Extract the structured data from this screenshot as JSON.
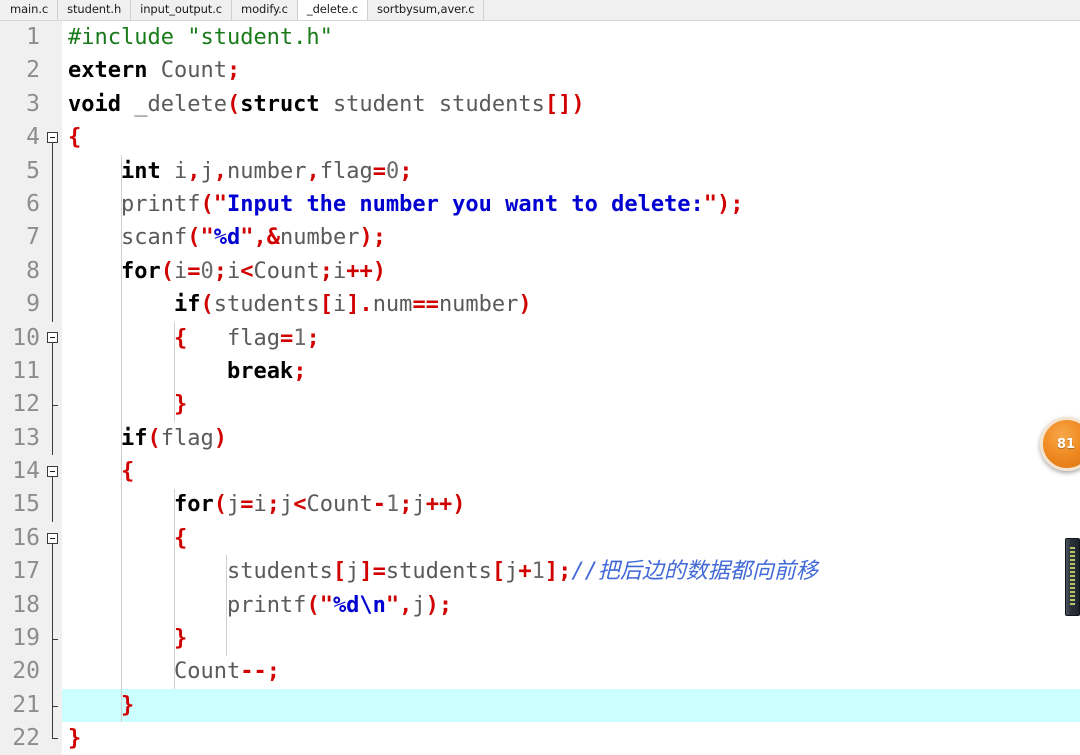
{
  "window": {
    "title": "_delete.c"
  },
  "tabs": [
    {
      "label": "main.c",
      "active": false
    },
    {
      "label": "student.h",
      "active": false
    },
    {
      "label": "input_output.c",
      "active": false
    },
    {
      "label": "modify.c",
      "active": false
    },
    {
      "label": "_delete.c",
      "active": true
    },
    {
      "label": "sortbysum,aver.c",
      "active": false
    }
  ],
  "editor": {
    "current_line": 21,
    "first_line": 1,
    "last_line": 22,
    "colors": {
      "background": "#ffffff",
      "gutter_background": "#f0f0f0",
      "line_number": "#8d8d8d",
      "current_line_highlight": "#ccffff",
      "keyword": "#000000",
      "preprocessor": "#1a7a1a",
      "string": "#0000d0",
      "operator": "#d00000",
      "identifier": "#555555",
      "comment": "#4169d8"
    },
    "lines": [
      {
        "n": 1,
        "fold": "none",
        "text": "#include \"student.h\""
      },
      {
        "n": 2,
        "fold": "none",
        "text": "extern Count;"
      },
      {
        "n": 3,
        "fold": "none",
        "text": "void _delete(struct student students[])"
      },
      {
        "n": 4,
        "fold": "box",
        "text": "{"
      },
      {
        "n": 5,
        "fold": "line",
        "text": "    int i,j,number,flag=0;"
      },
      {
        "n": 6,
        "fold": "line",
        "text": "    printf(\"Input the number you want to delete:\");"
      },
      {
        "n": 7,
        "fold": "line",
        "text": "    scanf(\"%d\",&number);"
      },
      {
        "n": 8,
        "fold": "line",
        "text": "    for(i=0;i<Count;i++)"
      },
      {
        "n": 9,
        "fold": "line",
        "text": "        if(students[i].num==number)"
      },
      {
        "n": 10,
        "fold": "box",
        "text": "        {   flag=1;"
      },
      {
        "n": 11,
        "fold": "line",
        "text": "            break;"
      },
      {
        "n": 12,
        "fold": "end",
        "text": "        }"
      },
      {
        "n": 13,
        "fold": "line",
        "text": "    if(flag)"
      },
      {
        "n": 14,
        "fold": "box",
        "text": "    {"
      },
      {
        "n": 15,
        "fold": "line",
        "text": "        for(j=i;j<Count-1;j++)"
      },
      {
        "n": 16,
        "fold": "box",
        "text": "        {"
      },
      {
        "n": 17,
        "fold": "line",
        "text": "            students[j]=students[j+1];//把后边的数据都向前移"
      },
      {
        "n": 18,
        "fold": "line",
        "text": "            printf(\"%d\\n\",j);"
      },
      {
        "n": 19,
        "fold": "end",
        "text": "        }"
      },
      {
        "n": 20,
        "fold": "line",
        "text": "        Count--;"
      },
      {
        "n": 21,
        "fold": "end",
        "text": "    }"
      },
      {
        "n": 22,
        "fold": "corner",
        "text": "}"
      }
    ]
  },
  "widgets": {
    "badge": {
      "label": "81",
      "color": "#ef8a22"
    },
    "scrollbar": {
      "name": "vertical-scrollbar"
    }
  }
}
